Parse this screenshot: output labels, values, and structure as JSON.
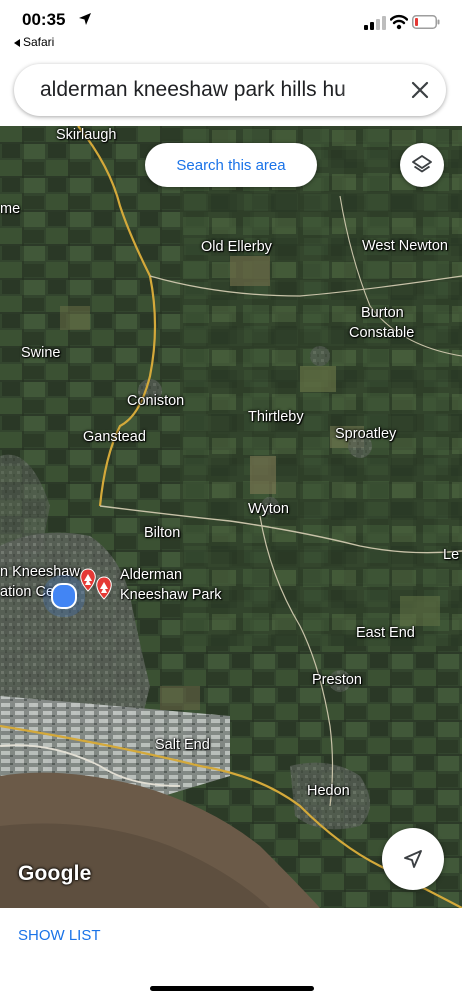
{
  "status_bar": {
    "time": "00:35",
    "back_app": "Safari",
    "location_icon": "location-arrow-icon",
    "signal_icon": "cellular-signal-icon",
    "wifi_icon": "wifi-icon",
    "battery_icon": "battery-low-icon",
    "battery_color": "#e53935"
  },
  "search": {
    "query": "alderman kneeshaw park hills hu",
    "clear_icon": "close-icon"
  },
  "map": {
    "search_area_label": "Search this area",
    "layers_icon": "layers-icon",
    "navigate_icon": "navigation-arrow-icon",
    "logo": "Google",
    "places": {
      "skirlaugh": "Skirlaugh",
      "me": "me",
      "old_ellerby": "Old Ellerby",
      "west_newton": "West Newton",
      "burton": "Burton",
      "constable": "Constable",
      "swine": "Swine",
      "coniston": "Coniston",
      "thirtleby": "Thirtleby",
      "ganstead": "Ganstead",
      "sproatley": "Sproatley",
      "wyton": "Wyton",
      "bilton": "Bilton",
      "le": "Le",
      "kneeshaw_center_1": "n Kneeshaw",
      "kneeshaw_center_2": "ation Ce",
      "alderman": "Alderman",
      "kneeshaw_park": "Kneeshaw Park",
      "east_end": "East End",
      "preston": "Preston",
      "salt_end": "Salt End",
      "hedon": "Hedon"
    },
    "park_pin_icon": "park-tree-pin-icon",
    "my_location_icon": "my-location-dot-icon",
    "accent": "#1a73e8",
    "location_dot_color": "#4285f4",
    "park_pin_color": "#e53935"
  },
  "bottom": {
    "show_list_label": "SHOW LIST"
  }
}
